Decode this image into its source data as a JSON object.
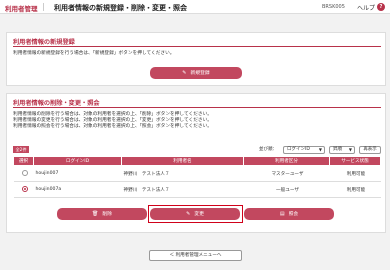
{
  "header": {
    "brand": "利用者管理",
    "title": "利用者情報の新規登録・削除・変更・照会",
    "screen_code": "BRSK005",
    "help_label": "ヘルプ",
    "help_icon": "?"
  },
  "register_section": {
    "title": "利用者情報の新規登録",
    "description": "利用者情報の新規登録を行う場合は、「新規登録」ボタンを押してください。",
    "new_button_label": "新規登録"
  },
  "manage_section": {
    "title": "利用者情報の削除・変更・照会",
    "descriptions": [
      "利用者情報の削除を行う場合は、対象の利用者を選択の上、「削除」ボタンを押してください。",
      "利用者情報の変更を行う場合は、対象の利用者を選択の上、「変更」ボタンを押してください。",
      "利用者情報の照会を行う場合は、対象の利用者を選択の上、「照会」ボタンを押してください。"
    ],
    "count_badge": "全2件",
    "sort_label": "並び順：",
    "sort_key": "ログインID",
    "sort_order": "昇順",
    "resort_button": "再表示",
    "columns": [
      "選択",
      "ログインID",
      "利用者名",
      "利用者区分",
      "サービス状態"
    ],
    "rows": [
      {
        "selected": false,
        "login_id": "houjin007",
        "name": "神野川　テスト法人７",
        "type": "マスターユーザ",
        "status": "利用可能"
      },
      {
        "selected": true,
        "login_id": "houjin007a",
        "name": "神野川　テスト法人７",
        "type": "一般ユーザ",
        "status": "利用可能"
      }
    ],
    "delete_label": "削除",
    "change_label": "変更",
    "inquiry_label": "照会"
  },
  "footer": {
    "back_label": "利用者管理メニューへ"
  }
}
